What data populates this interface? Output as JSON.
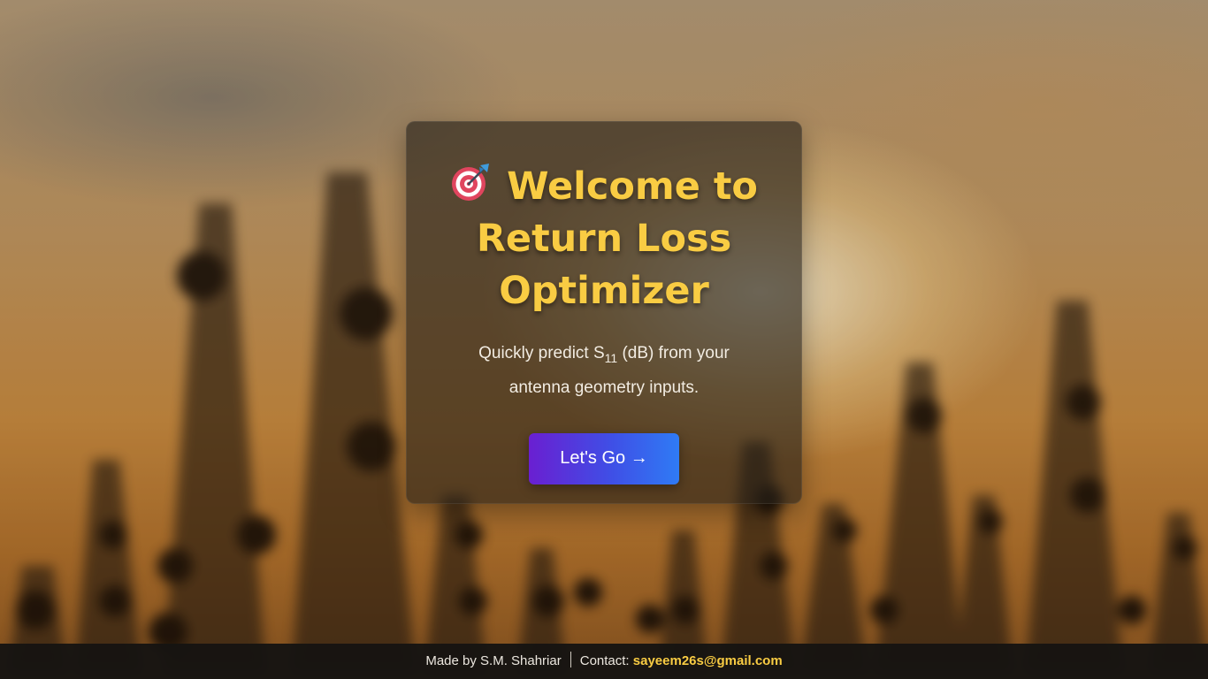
{
  "hero": {
    "icon": "dart-target-icon",
    "title_line1": "Welcome to",
    "title_line2": "Return Loss",
    "title_line3": "Optimizer",
    "subtitle_before": "Quickly predict S",
    "subtitle_sub": "11",
    "subtitle_after": " (dB) from your antenna geometry inputs.",
    "button_label": "Let's Go →"
  },
  "footer": {
    "made_by": "Made by S.M. Shahriar",
    "contact_label": "Contact:",
    "email": "sayeem26s@gmail.com"
  },
  "colors": {
    "title": "#f9cc43",
    "button_start": "#6a1fd1",
    "button_end": "#2f7bf5",
    "footer_bg": "#161412",
    "email": "#f9cc43"
  }
}
